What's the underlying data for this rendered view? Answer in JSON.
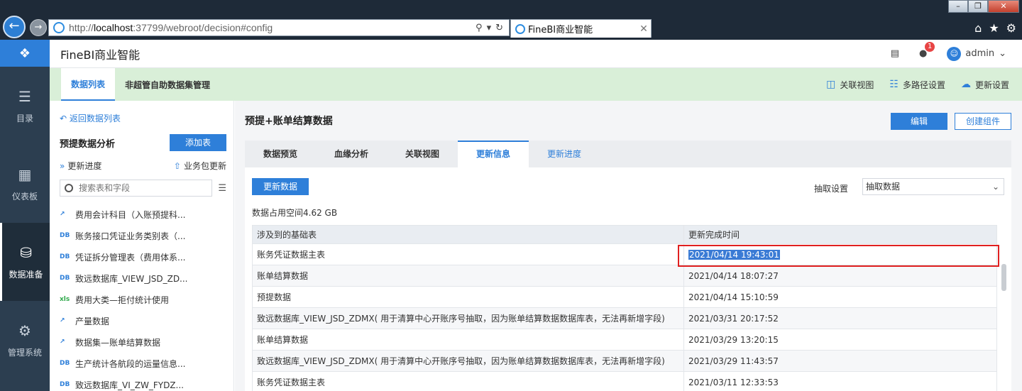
{
  "browser": {
    "url_prefix": "http://",
    "url_host": "localhost",
    "url_rest": ":37799/webroot/decision#config",
    "tab_title": "FineBI商业智能"
  },
  "leftnav": {
    "items": [
      {
        "label": "目录",
        "icon": "list-icon"
      },
      {
        "label": "仪表板",
        "icon": "dashboard-icon"
      },
      {
        "label": "数据准备",
        "icon": "database-icon",
        "active": true
      },
      {
        "label": "管理系统",
        "icon": "gear-icon"
      }
    ]
  },
  "header": {
    "app_title": "FineBI商业智能",
    "notification_count": "1",
    "user": "admin"
  },
  "subbar": {
    "tabs": [
      "数据列表",
      "非超管自助数据集管理"
    ],
    "actions": [
      "关联视图",
      "多路径设置",
      "更新设置"
    ]
  },
  "leftpanel": {
    "back": "返回数据列表",
    "package_name": "预提数据分析",
    "add_table": "添加表",
    "update_progress": "更新进度",
    "package_update": "业务包更新",
    "search_placeholder": "搜索表和字段",
    "items": [
      {
        "type": "etl",
        "label": "费用会计科目（入账预提科..."
      },
      {
        "type": "DB",
        "label": "账务接口凭证业务类别表（..."
      },
      {
        "type": "DB",
        "label": "凭证拆分管理表（费用体系..."
      },
      {
        "type": "DB",
        "label": "致远数据库_VIEW_JSD_ZD..."
      },
      {
        "type": "xls",
        "label": "费用大类—拒付统计使用"
      },
      {
        "type": "etl",
        "label": "产量数据"
      },
      {
        "type": "etl",
        "label": "数据集—账单结算数据"
      },
      {
        "type": "DB",
        "label": "生产统计各航段的运量信息..."
      },
      {
        "type": "DB",
        "label": "致远数据库_VI_ZW_FYDZ..."
      }
    ]
  },
  "main": {
    "title": "预提+账单结算数据",
    "edit": "编辑",
    "create_component": "创建组件",
    "tabs": [
      "数据预览",
      "血缘分析",
      "关联视图",
      "更新信息",
      "更新进度"
    ],
    "active_tab": "更新信息",
    "refresh": "更新数据",
    "extract_label": "抽取设置",
    "extract_value": "抽取数据",
    "space_used": "数据占用空间4.62 GB",
    "table": {
      "headers": [
        "涉及到的基础表",
        "更新完成时间"
      ],
      "rows": [
        [
          "账务凭证数据主表",
          "2021/04/14 19:43:01"
        ],
        [
          "账单结算数据",
          "2021/04/14 18:07:27"
        ],
        [
          "预提数据",
          "2021/04/14 15:10:59"
        ],
        [
          "致远数据库_VIEW_JSD_ZDMX( 用于清算中心开账序号抽取，因为账单结算数据数据库表，无法再新增字段)",
          "2021/03/31 20:17:52"
        ],
        [
          "账单结算数据",
          "2021/03/29 13:20:15"
        ],
        [
          "致远数据库_VIEW_JSD_ZDMX( 用于清算中心开账序号抽取，因为账单结算数据数据库表，无法再新增字段)",
          "2021/03/29 11:43:57"
        ],
        [
          "账务凭证数据主表",
          "2021/03/11 12:33:53"
        ]
      ]
    }
  },
  "colors": {
    "accent": "#2e7fd9",
    "nav_bg": "#2c3e50",
    "subbar_bg": "#d9efd8",
    "highlight": "#e02020"
  }
}
